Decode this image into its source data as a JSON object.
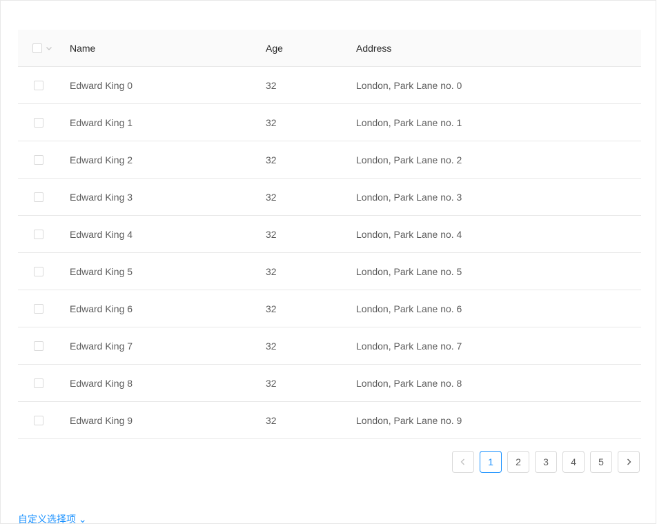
{
  "table": {
    "columns": {
      "name": "Name",
      "age": "Age",
      "address": "Address"
    },
    "rows": [
      {
        "name": "Edward King 0",
        "age": "32",
        "address": "London, Park Lane no. 0"
      },
      {
        "name": "Edward King 1",
        "age": "32",
        "address": "London, Park Lane no. 1"
      },
      {
        "name": "Edward King 2",
        "age": "32",
        "address": "London, Park Lane no. 2"
      },
      {
        "name": "Edward King 3",
        "age": "32",
        "address": "London, Park Lane no. 3"
      },
      {
        "name": "Edward King 4",
        "age": "32",
        "address": "London, Park Lane no. 4"
      },
      {
        "name": "Edward King 5",
        "age": "32",
        "address": "London, Park Lane no. 5"
      },
      {
        "name": "Edward King 6",
        "age": "32",
        "address": "London, Park Lane no. 6"
      },
      {
        "name": "Edward King 7",
        "age": "32",
        "address": "London, Park Lane no. 7"
      },
      {
        "name": "Edward King 8",
        "age": "32",
        "address": "London, Park Lane no. 8"
      },
      {
        "name": "Edward King 9",
        "age": "32",
        "address": "London, Park Lane no. 9"
      }
    ]
  },
  "pagination": {
    "pages": [
      "1",
      "2",
      "3",
      "4",
      "5"
    ],
    "current": "1",
    "prev_icon": "chevron-left-icon",
    "next_icon": "chevron-right-icon"
  },
  "footer": {
    "link_text": "自定义选择项 ⌄"
  },
  "colors": {
    "accent": "#1890ff",
    "border": "#e8e8e8",
    "header_bg": "#fafafa"
  }
}
